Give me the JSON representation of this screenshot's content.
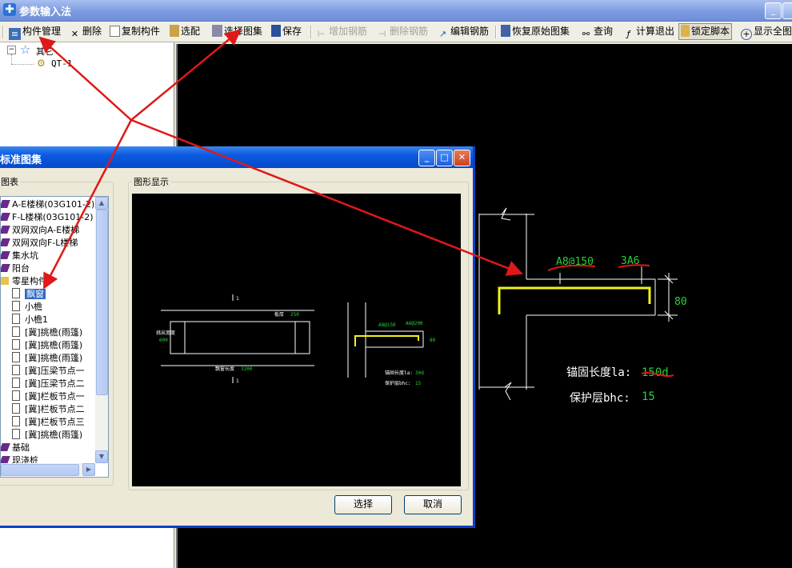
{
  "app": {
    "title": "参数输入法"
  },
  "toolbar": {
    "component_mgmt": "构件管理",
    "delete": "删除",
    "copy_component": "复制构件",
    "select_config": "选配",
    "select_atlas": "选择图集",
    "save": "保存",
    "add_rebar": "增加钢筋",
    "delete_rebar": "删除钢筋",
    "edit_rebar": "编辑钢筋",
    "restore_atlas": "恢复原始图集",
    "query": "查询",
    "calc_exit": "计算退出",
    "lock_script": "锁定脚本",
    "show_full": "显示全图"
  },
  "tree": {
    "root": "其它",
    "child": "QT-1"
  },
  "dialog": {
    "title": "标准图集",
    "list_legend": "图表",
    "preview_legend": "图形显示",
    "items": [
      {
        "label": "A-E楼梯(03G101-2)",
        "kind": "folder"
      },
      {
        "label": "F-L楼梯(03G101-2)",
        "kind": "folder"
      },
      {
        "label": "双网双向A-E楼梯",
        "kind": "folder"
      },
      {
        "label": "双网双向F-L楼梯",
        "kind": "folder"
      },
      {
        "label": "集水坑",
        "kind": "folder"
      },
      {
        "label": "阳台",
        "kind": "folder"
      },
      {
        "label": "零星构件",
        "kind": "open-folder"
      },
      {
        "label": "飘窗",
        "kind": "page",
        "selected": true
      },
      {
        "label": "小檐",
        "kind": "page"
      },
      {
        "label": "小檐1",
        "kind": "page"
      },
      {
        "label": "[冀]挑檐(雨篷)",
        "kind": "page"
      },
      {
        "label": "[冀]挑檐(雨篷)",
        "kind": "page"
      },
      {
        "label": "[冀]挑檐(雨篷)",
        "kind": "page"
      },
      {
        "label": "[冀]压梁节点一",
        "kind": "page"
      },
      {
        "label": "[冀]压梁节点二",
        "kind": "page"
      },
      {
        "label": "[冀]栏板节点一",
        "kind": "page"
      },
      {
        "label": "[冀]栏板节点二",
        "kind": "page"
      },
      {
        "label": "[冀]栏板节点三",
        "kind": "page"
      },
      {
        "label": "[冀]挑檐(雨篷)",
        "kind": "page"
      },
      {
        "label": "基础",
        "kind": "folder"
      },
      {
        "label": "现浇桩",
        "kind": "folder"
      }
    ],
    "ok": "选择",
    "cancel": "取消"
  },
  "preview": {
    "thickness_label": "板厚",
    "thickness_value": "250",
    "extend_label": "挑出宽度",
    "extend_value": "600",
    "length_label": "飘窗长度",
    "length_value": "3200",
    "top_rebar": "A8@150",
    "dist_rebar": "A6@200",
    "dim": "80",
    "anchor_label": "锚固长度la:",
    "anchor_value": "30d",
    "cover_label": "保护层bhc:",
    "cover_value": "15",
    "section_mark": "1"
  },
  "canvas": {
    "top_rebar": "A8@150",
    "dist_rebar": "3A6",
    "dim": "80",
    "anchor_label": "锚固长度la:",
    "anchor_value": "150d",
    "cover_label": "保护层bhc:",
    "cover_value": "15"
  },
  "colors": {
    "accent_green": "#27d43a",
    "rebar_yellow": "#f2f21a",
    "annotation_red": "#e01818"
  }
}
